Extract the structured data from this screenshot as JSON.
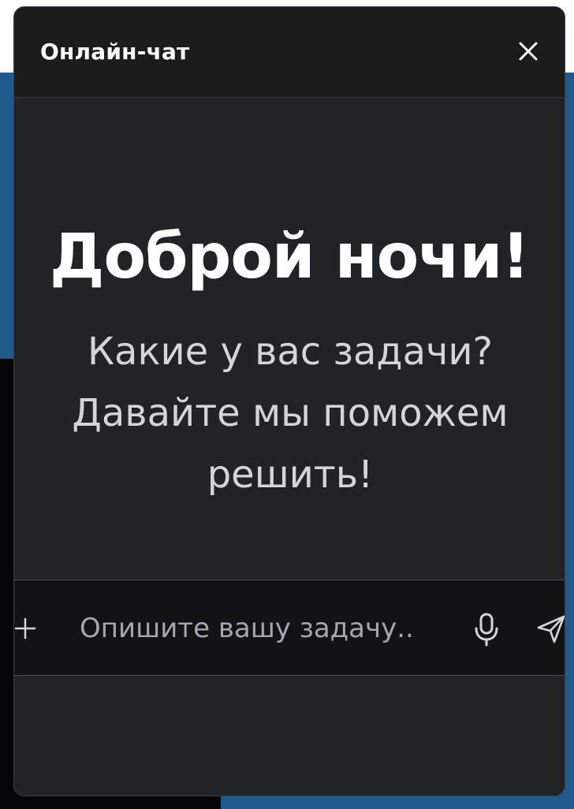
{
  "header": {
    "title": "Онлайн-чат",
    "close_icon": "close-icon"
  },
  "main": {
    "greeting": "Доброй ночи!",
    "subtitle": "Какие у вас задачи? Давайте мы поможем решить!"
  },
  "composer": {
    "placeholder": "Опишите вашу задачу..",
    "value": "",
    "icons": {
      "attach": "plus-icon",
      "voice": "microphone-icon",
      "send": "send-icon"
    }
  },
  "colors": {
    "panel_bg": "#222325",
    "header_bg": "#1c1c1d",
    "input_bg": "#121314",
    "text_primary": "#ffffff",
    "text_secondary": "#d4d5d8",
    "placeholder": "#a4a7ad",
    "page_accent": "#1f5a8a"
  }
}
